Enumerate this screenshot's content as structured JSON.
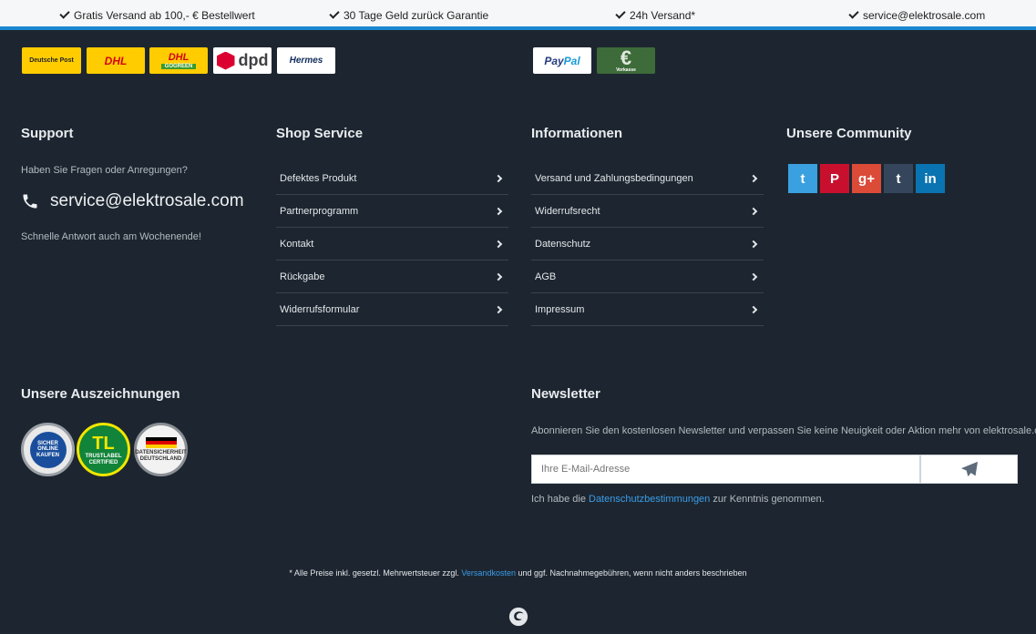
{
  "usp": [
    {
      "text": "Gratis Versand ab 100,- € Bestellwert",
      "icon": "check-icon"
    },
    {
      "text": "30 Tage Geld zurück Garantie",
      "icon": "check-icon"
    },
    {
      "text": "24h Versand*",
      "icon": "check-icon"
    },
    {
      "text": "service@elektrosale.com",
      "icon": "check-icon"
    }
  ],
  "shipping_logos": {
    "deutsche_post": "Deutsche Post",
    "dhl": "DHL",
    "dhl_gogreen": "DHL",
    "gogreen": "GOGREEN",
    "dpd": "dpd",
    "hermes": "Hermes"
  },
  "payment_logos": {
    "paypal_pay": "Pay",
    "paypal_pal": "Pal",
    "vorkasse": "Vorkasse"
  },
  "support": {
    "title": "Support",
    "question": "Haben Sie Fragen oder Anregungen?",
    "email": "service@elektrosale.com",
    "note": "Schnelle Antwort auch am Wochenende!"
  },
  "shop_service": {
    "title": "Shop Service",
    "items": [
      "Defektes Produkt",
      "Partnerprogramm",
      "Kontakt",
      "Rückgabe",
      "Widerrufsformular"
    ]
  },
  "informationen": {
    "title": "Informationen",
    "items": [
      "Versand und Zahlungsbedingungen",
      "Widerrufsrecht",
      "Datenschutz",
      "AGB",
      "Impressum"
    ]
  },
  "community": {
    "title": "Unsere Community",
    "networks": [
      {
        "name": "twitter",
        "glyph": "t",
        "color": "#3aa0e0"
      },
      {
        "name": "pinterest",
        "glyph": "P",
        "color": "#c8102e"
      },
      {
        "name": "google-plus",
        "glyph": "g+",
        "color": "#dc4a38"
      },
      {
        "name": "tumblr",
        "glyph": "t",
        "color": "#35465c"
      },
      {
        "name": "linkedin",
        "glyph": "in",
        "color": "#0a73b1"
      }
    ]
  },
  "awards": {
    "title": "Unsere Auszeichnungen",
    "badge1": "SICHER ONLINE KAUFEN",
    "badge2_big": "TL",
    "badge2": "TRUSTLABEL CERTIFIED",
    "badge3": "DATENSICHERHEIT DEUTSCHLAND"
  },
  "newsletter": {
    "title": "Newsletter",
    "description": "Abonnieren Sie den kostenlosen Newsletter und verpassen Sie keine Neuigkeit oder Aktion mehr von elektrosale.com.",
    "placeholder": "Ihre E-Mail-Adresse",
    "consent_pre": "Ich habe die ",
    "consent_link": "Datenschutzbestimmungen",
    "consent_post": " zur Kenntnis genommen."
  },
  "footer": {
    "note_pre": "* Alle Preise inkl. gesetzl. Mehrwertsteuer zzgl. ",
    "note_link": "Versandkosten",
    "note_post": " und ggf. Nachnahmegebühren, wenn nicht anders beschrieben"
  },
  "colors": {
    "background": "#1d2630",
    "accent": "#1a87d0",
    "link": "#3a9ce8"
  }
}
